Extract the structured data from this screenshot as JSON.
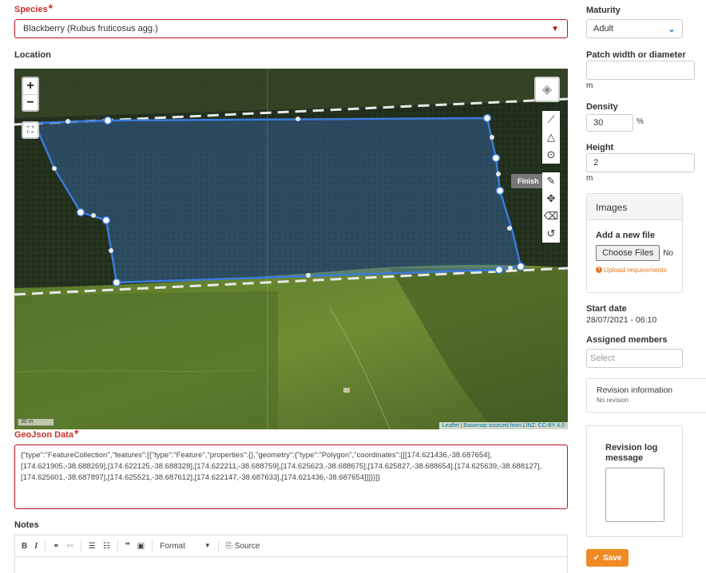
{
  "species": {
    "label": "Species",
    "value": "Blackberry (Rubus fruticosus agg.)"
  },
  "location": {
    "label": "Location"
  },
  "map": {
    "zoom_in": "+",
    "zoom_out": "−",
    "finish_label": "Finish",
    "scale_label": "30 m",
    "attribution": "Leaflet | Basemap sourced from LINZ. CC-BY 4.0",
    "polygon_color": "#3b7bdc"
  },
  "geojson": {
    "label": "GeoJson Data",
    "value": "{\"type\":\"FeatureCollection\",\"features\":[{\"type\":\"Feature\",\"properties\":{},\"geometry\":{\"type\":\"Polygon\",\"coordinates\":[[[174.621436,-38.687654],[174.621905,-38.688269],[174.622125,-38.688328],[174.622211,-38.688759],[174.625623,-38.688675],[174.625827,-38.688654],[174.625639,-38.688127],[174.625601,-38.687897],[174.625521,-38.687612],[174.622147,-38.687633],[174.621436,-38.687654]]]}}]}"
  },
  "notes": {
    "label": "Notes",
    "toolbar": {
      "format_label": "Format",
      "source_label": "Source"
    }
  },
  "maturity": {
    "label": "Maturity",
    "value": "Adult"
  },
  "patch": {
    "label": "Patch width or diameter",
    "value": "",
    "unit": "m"
  },
  "density": {
    "label": "Density",
    "value": "30",
    "unit": "%"
  },
  "height": {
    "label": "Height",
    "value": "2",
    "unit": "m"
  },
  "images": {
    "title": "Images",
    "add_label": "Add a new file",
    "choose_button": "Choose Files",
    "no_file": "No file chosen",
    "upload_req": "Upload requirements"
  },
  "start_date": {
    "label": "Start date",
    "value": "28/07/2021 - 06:10"
  },
  "assigned": {
    "label": "Assigned members",
    "placeholder": "Select"
  },
  "revision": {
    "title": "Revision information",
    "value": "No revision"
  },
  "revision_log": {
    "label": "Revision log message",
    "value": ""
  },
  "save": {
    "label": "Save"
  },
  "colors": {
    "required": "#d9232d",
    "save": "#f08a24",
    "accent": "#1e73be"
  }
}
